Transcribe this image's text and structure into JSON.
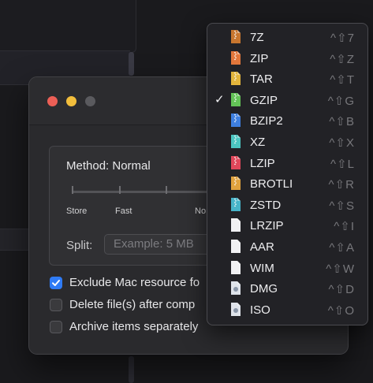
{
  "dialog": {
    "method_label": "Method: Normal",
    "slider": {
      "stops": [
        "Store",
        "Fast",
        "Normal"
      ],
      "visible_labels": [
        "Store",
        "Fast",
        "No"
      ]
    },
    "split_label": "Split:",
    "split_placeholder": "Example: 5 MB",
    "checkboxes": [
      {
        "label": "Exclude Mac resource fo",
        "checked": true
      },
      {
        "label": "Delete file(s) after comp",
        "checked": false
      },
      {
        "label": "Archive items separately",
        "checked": false
      }
    ]
  },
  "format_menu": {
    "selected": "GZIP",
    "items": [
      {
        "label": "7Z",
        "shortcut": "^⇧7",
        "icon": "archive-file-icon",
        "color": "#c8762f",
        "checked": false
      },
      {
        "label": "ZIP",
        "shortcut": "^⇧Z",
        "icon": "archive-file-icon",
        "color": "#e2773b",
        "checked": false
      },
      {
        "label": "TAR",
        "shortcut": "^⇧T",
        "icon": "archive-file-icon",
        "color": "#e3b53c",
        "checked": false
      },
      {
        "label": "GZIP",
        "shortcut": "^⇧G",
        "icon": "archive-file-icon",
        "color": "#63c357",
        "checked": true
      },
      {
        "label": "BZIP2",
        "shortcut": "^⇧B",
        "icon": "archive-file-icon",
        "color": "#3e7fe0",
        "checked": false
      },
      {
        "label": "XZ",
        "shortcut": "^⇧X",
        "icon": "archive-file-icon",
        "color": "#4cc6c1",
        "checked": false
      },
      {
        "label": "LZIP",
        "shortcut": "^⇧L",
        "icon": "archive-file-icon",
        "color": "#e0475a",
        "checked": false
      },
      {
        "label": "BROTLI",
        "shortcut": "^⇧R",
        "icon": "archive-file-icon",
        "color": "#e0a23e",
        "checked": false
      },
      {
        "label": "ZSTD",
        "shortcut": "^⇧S",
        "icon": "archive-file-icon",
        "color": "#47b4c9",
        "checked": false
      },
      {
        "label": "LRZIP",
        "shortcut": "^⇧I",
        "icon": "document-icon",
        "color": "#f1f1f3",
        "checked": false
      },
      {
        "label": "AAR",
        "shortcut": "^⇧A",
        "icon": "document-icon",
        "color": "#f1f1f3",
        "checked": false
      },
      {
        "label": "WIM",
        "shortcut": "^⇧W",
        "icon": "document-icon",
        "color": "#f1f1f3",
        "checked": false
      },
      {
        "label": "DMG",
        "shortcut": "^⇧D",
        "icon": "disk-image-icon",
        "color": "#dfe3ea",
        "checked": false
      },
      {
        "label": "ISO",
        "shortcut": "^⇧O",
        "icon": "disk-image-icon",
        "color": "#dfe3ea",
        "checked": false
      }
    ]
  }
}
